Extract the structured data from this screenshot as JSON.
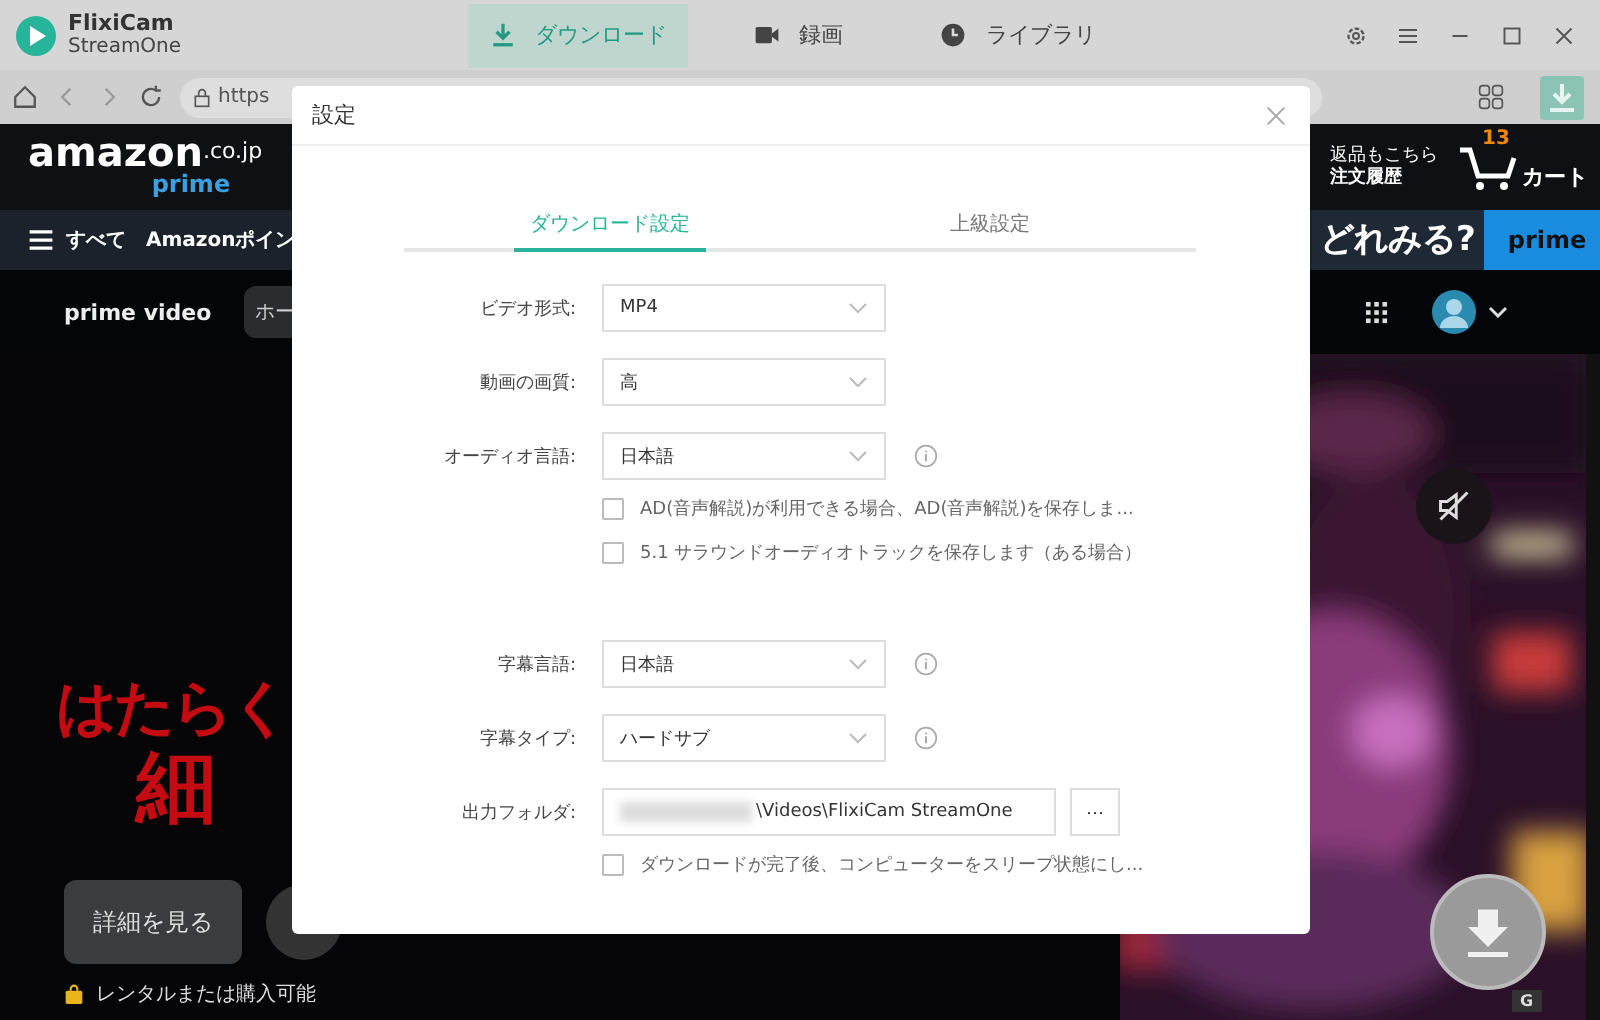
{
  "app": {
    "name": "FlixiCam",
    "subtitle": "StreamOne"
  },
  "main_tabs": [
    {
      "label": "ダウンロード",
      "selected": true
    },
    {
      "label": "録画",
      "selected": false
    },
    {
      "label": "ライブラリ",
      "selected": false
    }
  ],
  "browser": {
    "url": "https"
  },
  "amazon": {
    "logo": "amazon",
    "domain": ".co.jp",
    "prime": "prime",
    "orders_top": "返品もこちら",
    "orders": "注文履歴",
    "cart_count": "13",
    "cart": "カート",
    "menu": "すべて",
    "nav_item": "Amazonポイン",
    "banner": "どれみる?",
    "banner_prime": "prime"
  },
  "prime_video": {
    "logo": "prime video",
    "nav_item": "ホー"
  },
  "hero": {
    "title_lines": [
      "はたらく",
      "細"
    ],
    "details_button": "詳細を見る",
    "availability": "レンタルまたは購入可能",
    "badge": "G"
  },
  "dialog": {
    "title": "設定",
    "tabs": [
      {
        "label": "ダウンロード設定",
        "selected": true
      },
      {
        "label": "上級設定",
        "selected": false
      }
    ],
    "rows": [
      {
        "kind": "select",
        "label": "ビデオ形式:",
        "value": "MP4",
        "info": false
      },
      {
        "kind": "select",
        "label": "動画の画質:",
        "value": "高",
        "info": false
      },
      {
        "kind": "select",
        "label": "オーディオ言語:",
        "value": "日本語",
        "info": true
      },
      {
        "kind": "checkbox",
        "label": "AD(音声解説)が利用できる場合、AD(音声解説)を保存しま...",
        "checked": false
      },
      {
        "kind": "checkbox",
        "label": "5.1 サラウンドオーディオトラックを保存します（ある場合）",
        "checked": false
      },
      {
        "kind": "gap"
      },
      {
        "kind": "select",
        "label": "字幕言語:",
        "value": "日本語",
        "info": true
      },
      {
        "kind": "select",
        "label": "字幕タイプ:",
        "value": "ハードサブ",
        "info": true
      },
      {
        "kind": "folder",
        "label": "出力フォルダ:",
        "value": "\\Videos\\FlixiCam StreamOne",
        "button": "···"
      },
      {
        "kind": "checkbox",
        "label": "ダウンロードが完了後、コンピューターをスリープ状態にし...",
        "checked": false
      }
    ]
  }
}
